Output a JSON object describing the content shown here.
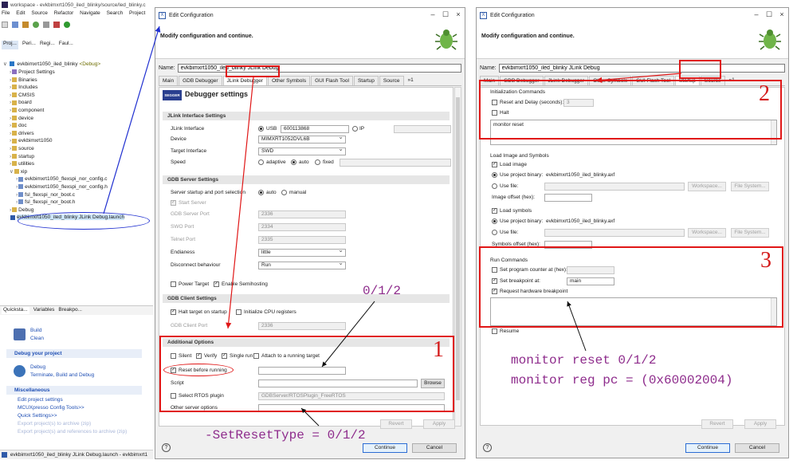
{
  "eclipse": {
    "title": "workspace - evkbimxrt1050_iled_blinky/source/led_blinky.c",
    "menu": [
      "File",
      "Edit",
      "Source",
      "Refactor",
      "Navigate",
      "Search",
      "Project"
    ],
    "views": [
      "Proj...",
      "Peri...",
      "Regi...",
      "Faul..."
    ],
    "project_root": "evkbimxrt1050_iled_blinky",
    "project_root_suffix": "<Debug>",
    "tree": [
      {
        "label": "Project Settings",
        "depth": 1,
        "kind": "settings"
      },
      {
        "label": "Binaries",
        "depth": 1,
        "kind": "folder"
      },
      {
        "label": "Includes",
        "depth": 1,
        "kind": "folder"
      },
      {
        "label": "CMSIS",
        "depth": 1,
        "kind": "folder"
      },
      {
        "label": "board",
        "depth": 1,
        "kind": "folder"
      },
      {
        "label": "component",
        "depth": 1,
        "kind": "folder"
      },
      {
        "label": "device",
        "depth": 1,
        "kind": "folder"
      },
      {
        "label": "doc",
        "depth": 1,
        "kind": "folder"
      },
      {
        "label": "drivers",
        "depth": 1,
        "kind": "folder"
      },
      {
        "label": "evkbimxrt1050",
        "depth": 1,
        "kind": "folder"
      },
      {
        "label": "source",
        "depth": 1,
        "kind": "folder"
      },
      {
        "label": "startup",
        "depth": 1,
        "kind": "folder"
      },
      {
        "label": "utilities",
        "depth": 1,
        "kind": "folder"
      },
      {
        "label": "xip",
        "depth": 1,
        "kind": "folder-open"
      },
      {
        "label": "evkbimxrt1050_flexspi_nor_config.c",
        "depth": 2,
        "kind": "file"
      },
      {
        "label": "evkbimxrt1050_flexspi_nor_config.h",
        "depth": 2,
        "kind": "file"
      },
      {
        "label": "fsl_flexspi_nor_boot.c",
        "depth": 2,
        "kind": "file"
      },
      {
        "label": "fsl_flexspi_nor_boot.h",
        "depth": 2,
        "kind": "file"
      },
      {
        "label": "Debug",
        "depth": 1,
        "kind": "folder"
      },
      {
        "label": "evkbimxrt1050_iled_blinky JLink Debug.launch",
        "depth": 1,
        "kind": "launch"
      }
    ],
    "bottom_tabs": [
      "Quicksta...",
      "Variables",
      "Breakpo..."
    ],
    "quickstart": {
      "build": "Build",
      "clean": "Clean",
      "debug_header": "Debug your project",
      "debug": "Debug",
      "terminate": "Terminate, Build and Debug",
      "misc_header": "Miscellaneous",
      "misc_items": [
        "Edit project settings",
        "MCUXpresso Config Tools>>",
        "Quick Settings>>"
      ],
      "misc_disabled": [
        "Export project(s) to archive (zip)",
        "Export project(s) and references to archive (zip)"
      ]
    },
    "status": "evkbimxrt1050_iled_blinky JLink Debug.launch - evkbimxrt1"
  },
  "dialog1": {
    "title": "Edit Configuration",
    "message": "Modify configuration and continue.",
    "name_label": "Name:",
    "name_value": "evkbimxrt1050_iled_blinky JLink Debug",
    "tabs": [
      "Main",
      "GDB Debugger",
      "JLink Debugger",
      "Other Symbols",
      "GUI Flash Tool",
      "Startup",
      "Source",
      "»1"
    ],
    "banner_title": "Debugger settings",
    "segger": "SEGGER",
    "jlink_iface_header": "JLink Interface Settings",
    "jlink_interface_label": "JLink Interface",
    "usb_label": "USB",
    "usb_serial": "600113868",
    "ip_label": "IP",
    "device_label": "Device",
    "device_value": "MIMXRT1052DVL6B",
    "target_iface_label": "Target Interface",
    "target_iface_value": "SWD",
    "speed_label": "Speed",
    "speed_options": [
      "adaptive",
      "auto",
      "fixed"
    ],
    "gdb_server_header": "GDB Server Settings",
    "server_startup_label": "Server startup and port selection",
    "server_options": [
      "auto",
      "manual"
    ],
    "start_server": "Start Server",
    "gdb_port_label": "GDB Server Port",
    "gdb_port": "2336",
    "swo_port_label": "SWO Port",
    "swo_port": "2334",
    "telnet_port_label": "Telnet Port",
    "telnet_port": "2335",
    "endianess_label": "Endianess",
    "endianess_value": "little",
    "disconnect_label": "Disconnect behaviour",
    "disconnect_value": "Run",
    "power_target": "Power Target",
    "semihosting": "Enable Semihosting",
    "gdb_client_header": "GDB Client Settings",
    "halt_target": "Halt target on startup",
    "init_regs": "Initialize CPU registers",
    "gdb_client_port_label": "GDB Client Port",
    "gdb_client_port": "2336",
    "additional_header": "Additional Options",
    "silent": "Silent",
    "verify": "Verify",
    "single_run": "Single run",
    "attach": "Attach to a running target",
    "reset_before": "Reset before running",
    "script_label": "Script",
    "browse": "Browse",
    "rtos_label": "Select RTOS plugin",
    "rtos_value": "GDBServer/RTOSPlugin_FreeRTOS",
    "other_server_label": "Other server options",
    "revert": "Revert",
    "apply": "Apply",
    "continue": "Continue",
    "cancel": "Cancel"
  },
  "dialog2": {
    "title": "Edit Configuration",
    "message": "Modify configuration and continue.",
    "name_label": "Name:",
    "name_value": "evkbimxrt1050_iled_blinky JLink Debug",
    "tabs": [
      "Main",
      "GDB Debugger",
      "JLink Debugger",
      "Other Symbols",
      "GUI Flash Tool",
      "Startup",
      "Source",
      "»1"
    ],
    "init_header": "Initialization Commands",
    "reset_delay": "Reset and Delay (seconds):",
    "reset_delay_value": "3",
    "halt": "Halt",
    "init_text": "monitor reset",
    "load_header": "Load Image and Symbols",
    "load_image": "Load image",
    "use_project_binary": "Use project binary:",
    "binary_name": "evkbimxrt1050_iled_blinky.axf",
    "use_file": "Use file:",
    "workspace_btn": "Workspace...",
    "filesystem_btn": "File System...",
    "image_offset": "Image offset (hex):",
    "load_symbols": "Load symbols",
    "symbols_offset": "Symbols offset (hex):",
    "run_header": "Run Commands",
    "set_pc": "Set program counter at (hex):",
    "set_bp": "Set breakpoint at:",
    "bp_value": "main",
    "hw_bp": "Request hardware breakpoint",
    "resume": "Resume",
    "revert": "Revert",
    "apply": "Apply",
    "continue": "Continue",
    "cancel": "Cancel"
  },
  "annotations": {
    "n1": "1",
    "n2": "2",
    "n3": "3",
    "reset_type_values": "0/1/2",
    "set_reset_type": "-SetResetType = 0/1/2",
    "monitor_reset": "monitor reset 0/1/2",
    "monitor_reg": "monitor reg pc = (0x60002004)"
  },
  "colors": {
    "annotation_red": "#e01616",
    "annotation_purple": "#8e2c8c",
    "arrow_blue": "#1f2fd0",
    "selection_blue": "#cce4f7"
  }
}
